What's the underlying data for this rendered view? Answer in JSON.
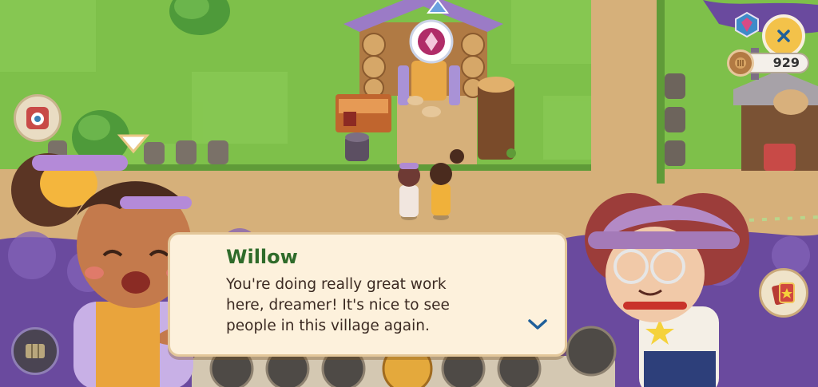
{
  "dialog": {
    "speaker": "Willow",
    "lines": [
      "You're doing really great work",
      "here, dreamer! It's nice to see",
      "people in this village again."
    ]
  },
  "hud": {
    "coins": "929"
  },
  "icons": [
    "close-icon",
    "gem-icon",
    "coin-icon",
    "cards-icon",
    "camera-icon",
    "map-icon",
    "chevron-down-icon"
  ],
  "colors": {
    "grass": "#7ec04a",
    "path": "#d6b07a",
    "fog": "#6a4a9e",
    "dialog_bg": "#fdf1dc",
    "speaker_name": "#2f6b2a",
    "close_button": "#f3c24a"
  }
}
